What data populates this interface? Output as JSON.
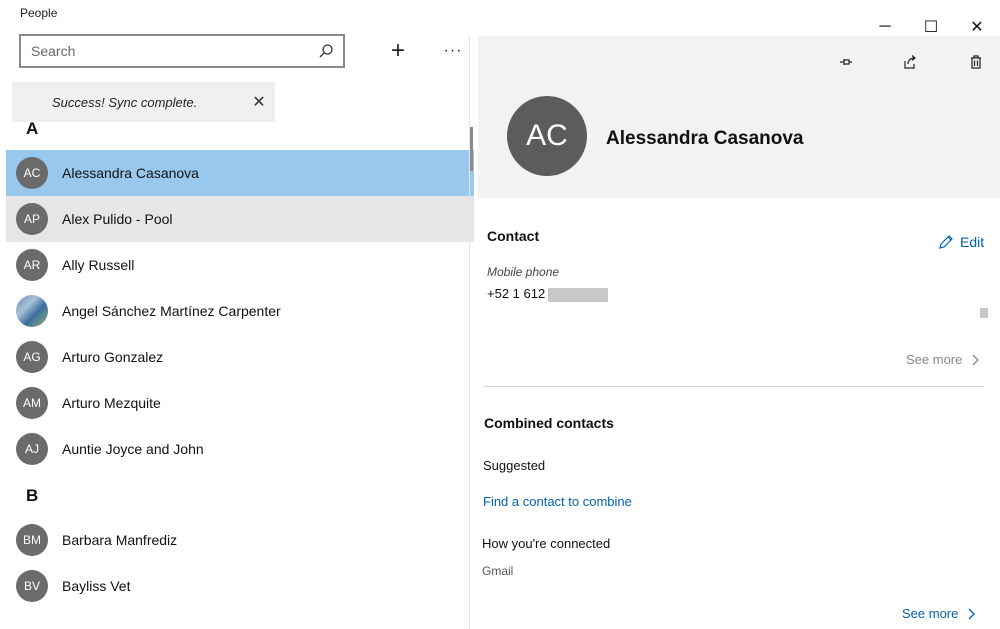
{
  "app": {
    "title": "People"
  },
  "window_controls": {
    "minimize": "─",
    "maximize": "☐",
    "close": "✕"
  },
  "search": {
    "placeholder": "Search",
    "value": ""
  },
  "toolbar": {
    "add_label": "+",
    "more_label": "···"
  },
  "toast": {
    "message": "Success! Sync complete.",
    "close_label": "✕"
  },
  "contact_list": {
    "groups": [
      {
        "letter": "A",
        "contacts": [
          {
            "initials": "AC",
            "name": "Alessandra Casanova"
          },
          {
            "initials": "AP",
            "name": "Alex Pulido - Pool"
          },
          {
            "initials": "AR",
            "name": "Ally Russell"
          },
          {
            "initials": "",
            "name": "Angel Sánchez Martínez Carpenter"
          },
          {
            "initials": "AG",
            "name": "Arturo Gonzalez"
          },
          {
            "initials": "AM",
            "name": "Arturo Mezquite"
          },
          {
            "initials": "AJ",
            "name": "Auntie Joyce and John"
          }
        ]
      },
      {
        "letter": "B",
        "contacts": [
          {
            "initials": "BM",
            "name": "Barbara Manfrediz"
          },
          {
            "initials": "BV",
            "name": "Bayliss Vet"
          }
        ]
      }
    ],
    "selected_index": 0,
    "hovered_index": 1
  },
  "detail": {
    "initials": "AC",
    "name": "Alessandra Casanova",
    "contact_section": {
      "title": "Contact",
      "edit_label": "Edit",
      "phone_label": "Mobile phone",
      "phone_value": "+52 1 612",
      "see_more_label": "See more"
    },
    "combined_section": {
      "title": "Combined contacts",
      "suggested_label": "Suggested",
      "find_link": "Find a contact to combine",
      "connected_label": "How you're connected",
      "source": "Gmail",
      "see_more_label": "See more"
    }
  },
  "colors": {
    "accent": "#0063b1",
    "selection": "#99c8ef",
    "avatar": "#6b6b6b"
  }
}
